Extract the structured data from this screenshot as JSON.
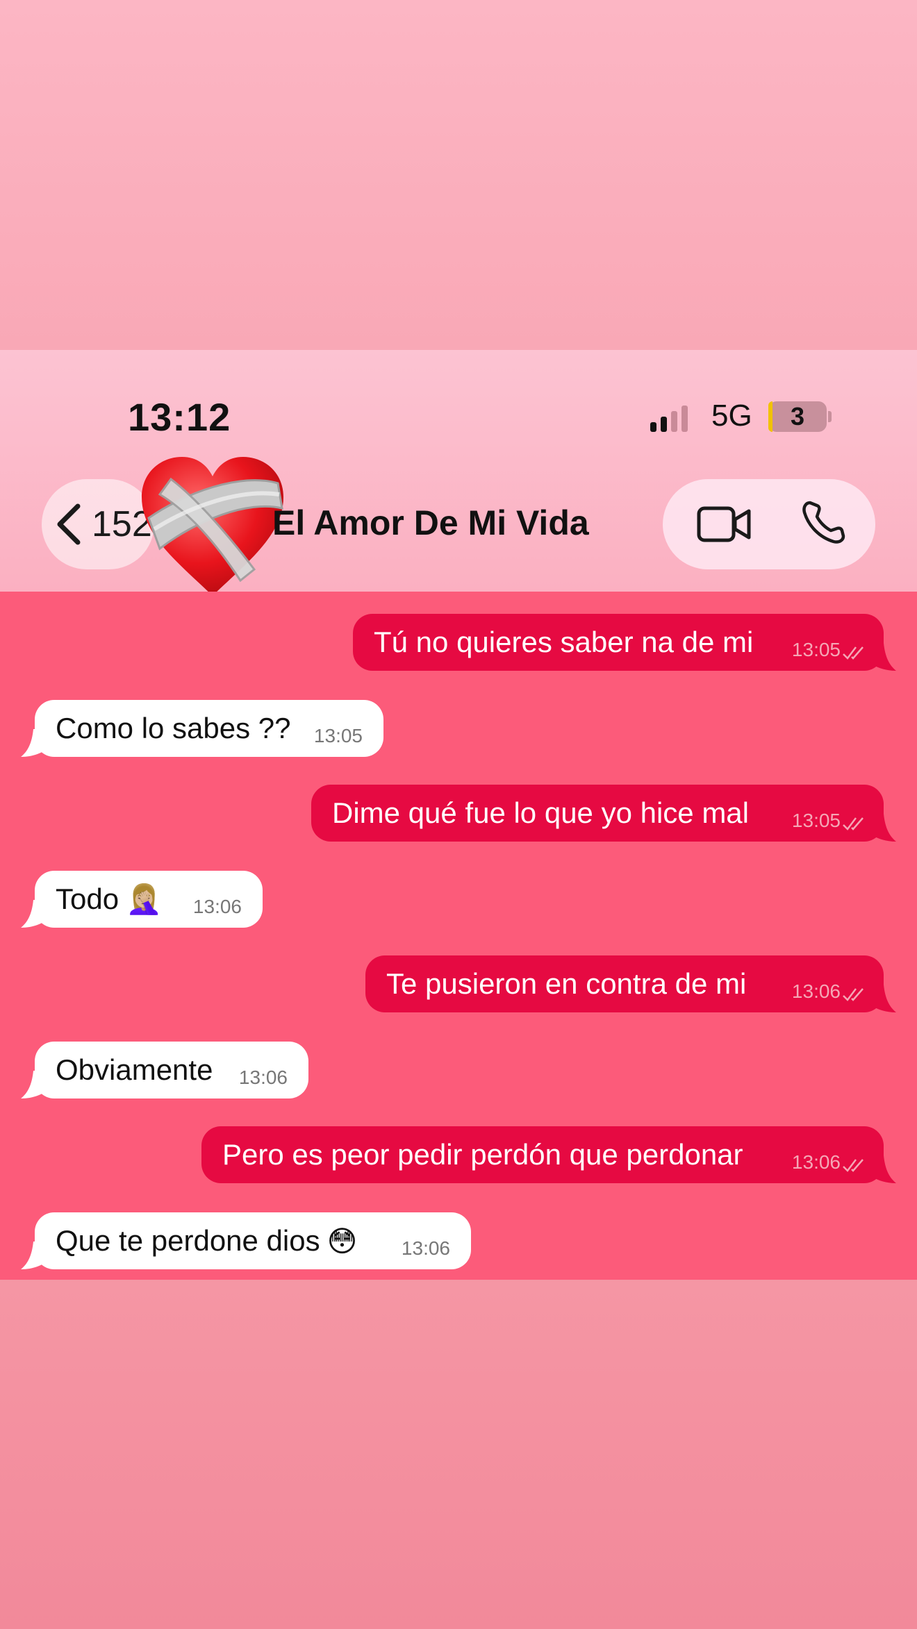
{
  "status_bar": {
    "time": "13:12",
    "network": "5G",
    "battery": "3"
  },
  "header": {
    "back_count": "152",
    "contact_name": "El Amor De Mi Vida"
  },
  "messages": [
    {
      "direction": "out",
      "text": "Tú no quieres saber na de mi",
      "time": "13:05"
    },
    {
      "direction": "in",
      "text": "Como lo sabes ??",
      "time": "13:05"
    },
    {
      "direction": "out",
      "text": "Dime qué fue lo que yo hice mal",
      "time": "13:05"
    },
    {
      "direction": "in",
      "text": "Todo",
      "emoji": "🤦🏼‍♀️",
      "time": "13:06"
    },
    {
      "direction": "out",
      "text": "Te pusieron en contra de mi",
      "time": "13:06"
    },
    {
      "direction": "in",
      "text": "Obviamente",
      "time": "13:06"
    },
    {
      "direction": "out",
      "text": "Pero es peor pedir perdón que perdonar",
      "time": "13:06"
    },
    {
      "direction": "in",
      "text": "Que te perdone dios",
      "emoji": "😳",
      "time": "13:06"
    }
  ],
  "colors": {
    "outgoing_bubble": "#e60a42",
    "incoming_bubble": "#ffffff",
    "chat_background": "#fc5b7a",
    "header_background": "#fbb8c8"
  },
  "icons": {
    "avatar": "mending-heart-icon",
    "back": "chevron-left-icon",
    "video": "video-camera-icon",
    "call": "phone-icon",
    "read": "double-check-icon"
  }
}
